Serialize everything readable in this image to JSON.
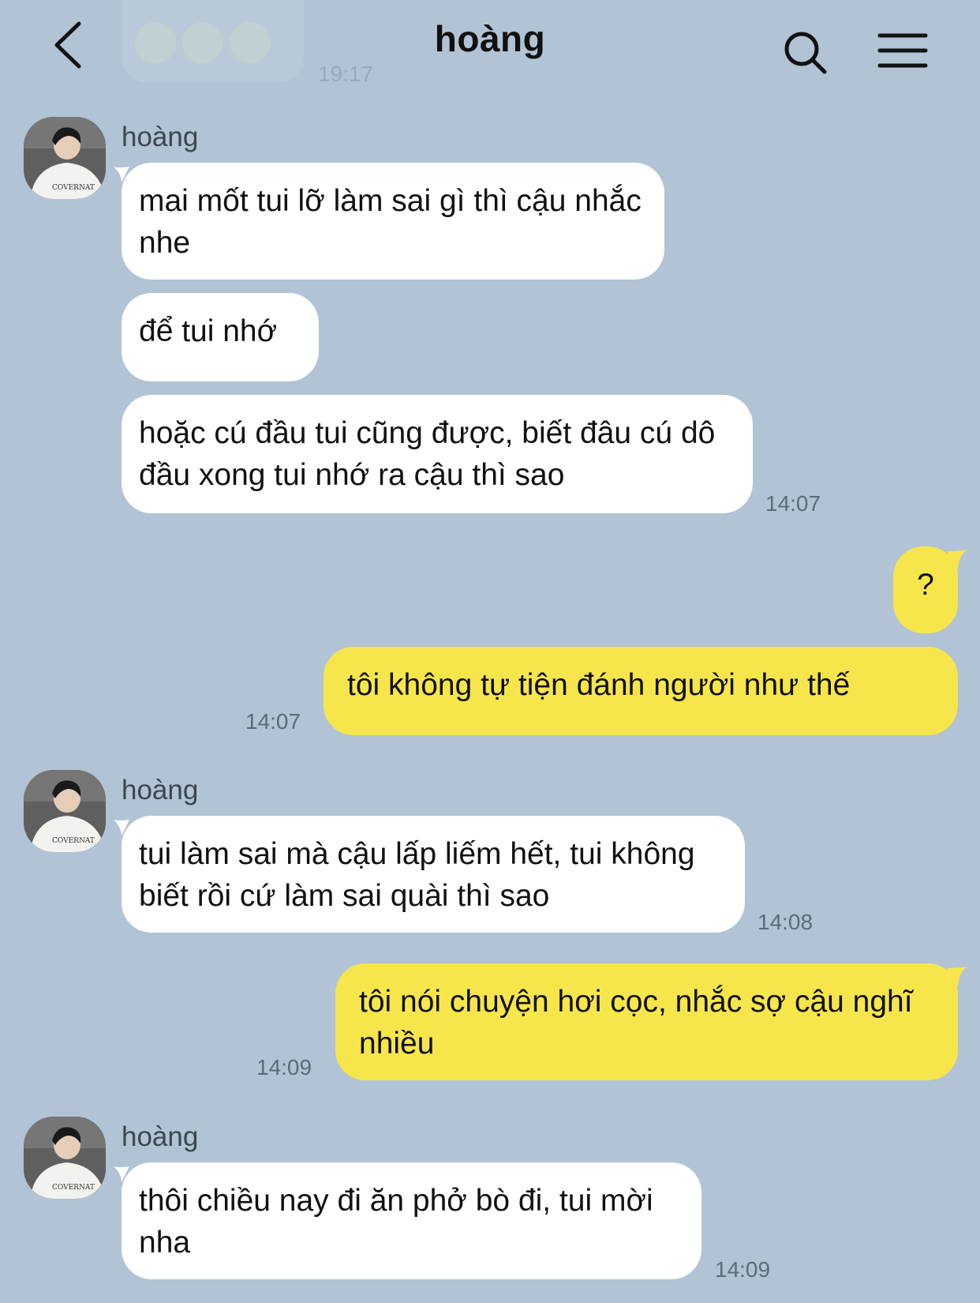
{
  "header": {
    "title": "hoàng",
    "back_icon": "chevron-left-icon",
    "search_icon": "search-icon",
    "menu_icon": "hamburger-menu-icon"
  },
  "previous_message": {
    "emojis": [
      "weary-face-emoji",
      "weary-face-emoji",
      "weary-face-emoji"
    ],
    "time": "19:17"
  },
  "messages": [
    {
      "sender": "hoàng",
      "side": "left",
      "text": "mai mốt tui lỡ làm sai gì thì cậu nhắc nhe",
      "time": ""
    },
    {
      "sender": "hoàng",
      "side": "left",
      "text": "để tui nhớ",
      "time": ""
    },
    {
      "sender": "hoàng",
      "side": "left",
      "text": "hoặc cú đầu tui cũng được, biết đâu cú dô đầu xong tui nhớ ra cậu thì sao",
      "time": "14:07"
    },
    {
      "side": "right",
      "text": "?",
      "time": ""
    },
    {
      "side": "right",
      "text": "tôi không tự tiện đánh người như thế",
      "time": "14:07"
    },
    {
      "sender": "hoàng",
      "side": "left",
      "text": "tui làm sai mà cậu lấp liếm hết, tui không biết rồi cứ làm sai quài thì sao",
      "time": "14:08"
    },
    {
      "side": "right",
      "text": "tôi nói chuyện hơi cọc, nhắc sợ cậu nghĩ nhiều",
      "time": "14:09"
    },
    {
      "sender": "hoàng",
      "side": "left",
      "text": "thôi chiều nay đi ăn phở bò đi, tui mời nha",
      "time": "14:09"
    }
  ],
  "colors": {
    "background": "#b1c3d5",
    "incoming_bubble": "#ffffff",
    "outgoing_bubble": "#f7e64b",
    "timestamp": "#5d6b79"
  }
}
